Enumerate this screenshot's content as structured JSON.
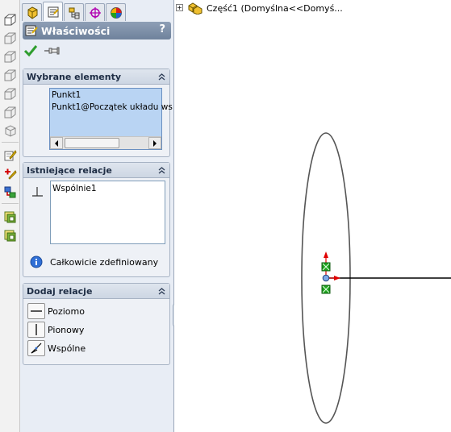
{
  "panel": {
    "title": "Właściwości",
    "help_icon": "?",
    "groups": {
      "selected": {
        "title": "Wybrane elementy",
        "items": [
          "Punkt1",
          "Punkt1@Początek układu ws"
        ]
      },
      "existing": {
        "title": "Istniejące relacje",
        "items": [
          "Wspólnie1"
        ],
        "status": "Całkowicie zdefiniowany"
      },
      "add": {
        "title": "Dodaj relacje",
        "options": [
          "Poziomo",
          "Pionowy",
          "Wspólne"
        ]
      }
    }
  },
  "graphics": {
    "tree_label": "Część1  (Domyślna<<Domyś..."
  },
  "icons": {
    "ok": "checkmark-icon",
    "pin": "pushpin-icon",
    "info": "info-icon",
    "collapse": "double-chevron-up-icon"
  },
  "colors": {
    "title_bar": "#7d8fa8",
    "group_header": "#d4dce8",
    "selection": "#b9d4f3",
    "ok_green": "#2e9d2e",
    "axis_red": "#e00000",
    "point_green": "#1fa31f"
  }
}
